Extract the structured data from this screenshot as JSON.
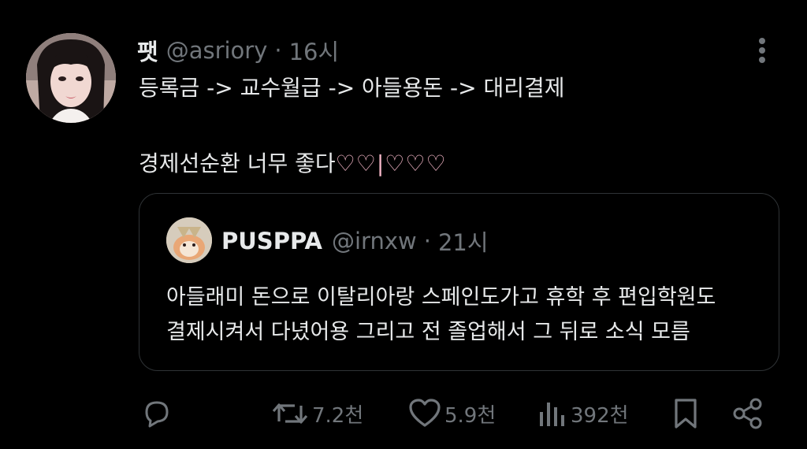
{
  "tweet": {
    "display_name": "팻",
    "handle": "@asriory",
    "separator": "·",
    "time": "16시",
    "text_line1": "등록금 -> 교수월급 -> 아들용돈 -> 대리결제",
    "text_line2_prefix": "경제선순환 너무 좋다",
    "text_line2_hearts": "♡♡|♡♡♡"
  },
  "quote": {
    "display_name": "PUSPPA",
    "handle": "@irnxw",
    "separator": "·",
    "time": "21시",
    "text_line1": "아들래미 돈으로 이탈리아랑 스페인도가고 휴학 후 편입학원도",
    "text_line2": "결제시켜서 다녔어용 그리고 전 졸업해서 그 뒤로 소식 모름"
  },
  "actions": {
    "reply_count": "",
    "retweet_count": "7.2천",
    "like_count": "5.9천",
    "views_count": "392천"
  },
  "icons": {
    "more": "more-vertical-icon",
    "reply": "reply-icon",
    "retweet": "retweet-icon",
    "like": "heart-icon",
    "views": "views-icon",
    "bookmark": "bookmark-icon",
    "share": "share-icon"
  },
  "colors": {
    "background": "#000000",
    "text": "#e7e9ea",
    "muted": "#71767b",
    "border": "#2f3336",
    "hearts": "#f6b8c9"
  }
}
